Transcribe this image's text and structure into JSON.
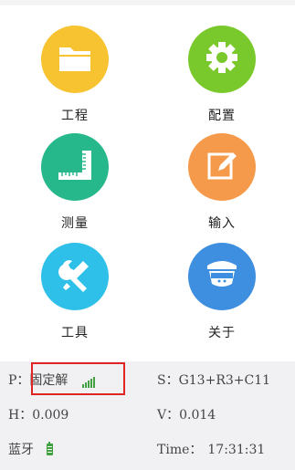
{
  "menu": {
    "project": {
      "label": "工程",
      "icon": "folder-icon",
      "color": "#f7c330"
    },
    "config": {
      "label": "配置",
      "icon": "gear-icon",
      "color": "#7ac92c"
    },
    "measure": {
      "label": "测量",
      "icon": "ruler-icon",
      "color": "#26b78a"
    },
    "input": {
      "label": "输入",
      "icon": "edit-icon",
      "color": "#f59a4a"
    },
    "tools": {
      "label": "工具",
      "icon": "tools-icon",
      "color": "#2ec0e8"
    },
    "about": {
      "label": "关于",
      "icon": "receiver-icon",
      "color": "#3e8fe0"
    }
  },
  "status": {
    "p_label": "P：",
    "p_value": "固定解",
    "s_label": "S：",
    "s_value": "G13+R3+C11",
    "h_label": "H：",
    "h_value": "0.009",
    "v_label": "V：",
    "v_value": "0.014",
    "bluetooth_label": "蓝牙",
    "time_label": "Time：",
    "time_value": "17:31:31"
  }
}
